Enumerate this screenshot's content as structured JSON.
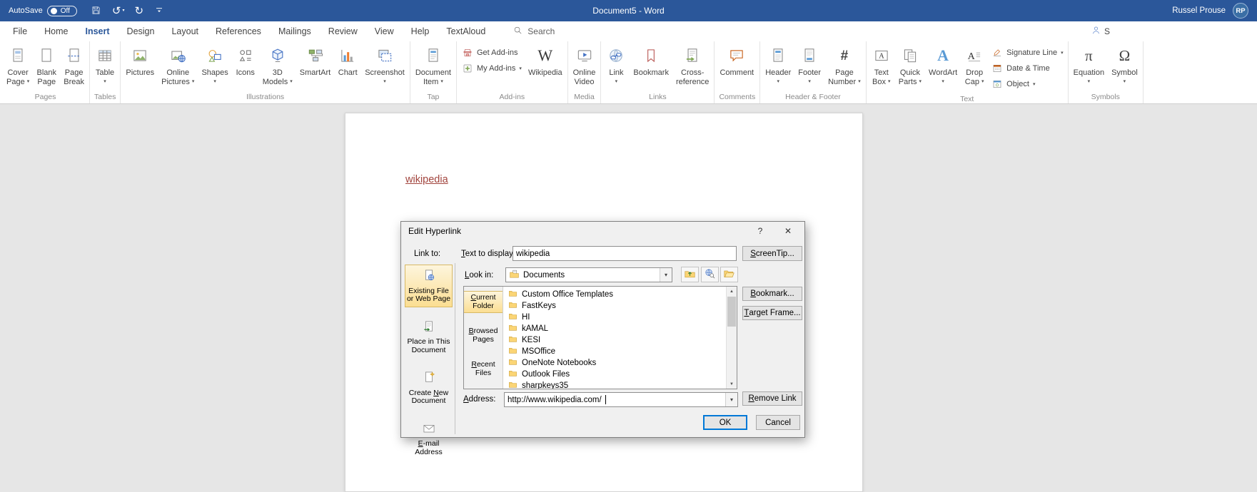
{
  "colors": {
    "title_bar": "#2b579a",
    "accent": "#2b579a",
    "selection_amber": "#fbde92",
    "hyperlink": "#a2453e",
    "ok_focus_border": "#0078d7"
  },
  "titlebar": {
    "autosave_label": "AutoSave",
    "autosave_state": "Off",
    "title": "Document5 - Word",
    "user_name": "Russel Prouse",
    "user_initials": "RP"
  },
  "menu": {
    "tabs": [
      {
        "label": "File"
      },
      {
        "label": "Home"
      },
      {
        "label": "Insert",
        "active": true
      },
      {
        "label": "Design"
      },
      {
        "label": "Layout"
      },
      {
        "label": "References"
      },
      {
        "label": "Mailings"
      },
      {
        "label": "Review"
      },
      {
        "label": "View"
      },
      {
        "label": "Help"
      },
      {
        "label": "TextAloud"
      }
    ],
    "search_label": "Search",
    "share_fragment": "S"
  },
  "ribbon": {
    "groups": [
      {
        "label": "Pages",
        "items": [
          {
            "type": "large",
            "lines": [
              "Cover",
              "Page"
            ],
            "icon": "cover-page",
            "caret": true
          },
          {
            "type": "large",
            "lines": [
              "Blank",
              "Page"
            ],
            "icon": "blank-page"
          },
          {
            "type": "large",
            "lines": [
              "Page",
              "Break"
            ],
            "icon": "page-break"
          }
        ]
      },
      {
        "label": "Tables",
        "items": [
          {
            "type": "large",
            "lines": [
              "Table"
            ],
            "icon": "table",
            "caret": true
          }
        ]
      },
      {
        "label": "Illustrations",
        "items": [
          {
            "type": "large",
            "lines": [
              "Pictures"
            ],
            "icon": "pictures"
          },
          {
            "type": "large",
            "lines": [
              "Online",
              "Pictures"
            ],
            "icon": "online-pictures",
            "caret": true
          },
          {
            "type": "large",
            "lines": [
              "Shapes"
            ],
            "icon": "shapes",
            "caret": true
          },
          {
            "type": "large",
            "lines": [
              "Icons"
            ],
            "icon": "icons"
          },
          {
            "type": "large",
            "lines": [
              "3D",
              "Models"
            ],
            "icon": "three-d-models",
            "caret": true
          },
          {
            "type": "large",
            "lines": [
              "SmartArt"
            ],
            "icon": "smartart"
          },
          {
            "type": "large",
            "lines": [
              "Chart"
            ],
            "icon": "chart"
          },
          {
            "type": "large",
            "lines": [
              "Screenshot"
            ],
            "icon": "screenshot",
            "caret": true
          }
        ]
      },
      {
        "label": "Tap",
        "items": [
          {
            "type": "large",
            "lines": [
              "Document",
              "Item"
            ],
            "icon": "document-item",
            "caret": true
          }
        ]
      },
      {
        "label": "Add-ins",
        "items": [
          {
            "type": "stack",
            "rows": [
              {
                "label": "Get Add-ins",
                "icon": "store"
              },
              {
                "label": "My Add-ins",
                "icon": "my-add-ins",
                "caret": true
              }
            ]
          },
          {
            "type": "large",
            "lines": [
              "Wikipedia"
            ],
            "icon": "wikipedia"
          }
        ]
      },
      {
        "label": "Media",
        "items": [
          {
            "type": "large",
            "lines": [
              "Online",
              "Video"
            ],
            "icon": "online-video"
          }
        ]
      },
      {
        "label": "Links",
        "items": [
          {
            "type": "large",
            "lines": [
              "Link"
            ],
            "icon": "link",
            "caret": true
          },
          {
            "type": "large",
            "lines": [
              "Bookmark"
            ],
            "icon": "bookmark"
          },
          {
            "type": "large",
            "lines": [
              "Cross-",
              "reference"
            ],
            "icon": "cross-reference"
          }
        ]
      },
      {
        "label": "Comments",
        "items": [
          {
            "type": "large",
            "lines": [
              "Comment"
            ],
            "icon": "comment"
          }
        ]
      },
      {
        "label": "Header & Footer",
        "items": [
          {
            "type": "large",
            "lines": [
              "Header"
            ],
            "icon": "header",
            "caret": true
          },
          {
            "type": "large",
            "lines": [
              "Footer"
            ],
            "icon": "footer",
            "caret": true
          },
          {
            "type": "large",
            "lines": [
              "Page",
              "Number"
            ],
            "icon": "page-number",
            "caret": true
          }
        ]
      },
      {
        "label": "Text",
        "items": [
          {
            "type": "large",
            "lines": [
              "Text",
              "Box"
            ],
            "icon": "text-box",
            "caret": true
          },
          {
            "type": "large",
            "lines": [
              "Quick",
              "Parts"
            ],
            "icon": "quick-parts",
            "caret": true
          },
          {
            "type": "large",
            "lines": [
              "WordArt"
            ],
            "icon": "wordart",
            "caret": true
          },
          {
            "type": "large",
            "lines": [
              "Drop",
              "Cap"
            ],
            "icon": "drop-cap",
            "caret": true
          },
          {
            "type": "stack",
            "rows": [
              {
                "label": "Signature Line",
                "icon": "signature-line",
                "caret": true
              },
              {
                "label": "Date & Time",
                "icon": "date-time"
              },
              {
                "label": "Object",
                "icon": "object",
                "caret": true
              }
            ]
          }
        ]
      },
      {
        "label": "Symbols",
        "items": [
          {
            "type": "large",
            "lines": [
              "Equation"
            ],
            "icon": "equation",
            "caret": true
          },
          {
            "type": "large",
            "lines": [
              "Symbol"
            ],
            "icon": "symbol",
            "caret": true
          }
        ]
      }
    ]
  },
  "document": {
    "link_text": "wikipedia"
  },
  "dialog": {
    "title": "Edit Hyperlink",
    "help_glyph": "?",
    "close_glyph": "✕",
    "link_to_label": "Link to:",
    "text_to_display": {
      "text": "Text to display:",
      "accel": 0
    },
    "text_to_display_value": "wikipedia",
    "screentip_button": {
      "text": "ScreenTip...",
      "accel": 0
    },
    "look_in": {
      "text": "Look in:",
      "accel": 0
    },
    "look_in_value": "Documents",
    "sidebar": [
      {
        "label": "Existing File or Web Page",
        "icon": "existing-file",
        "selected": true
      },
      {
        "label": "Place in This Document",
        "icon": "place-in-doc"
      },
      {
        "label": "Create New Document",
        "icon": "new-doc",
        "accel": 7
      },
      {
        "label": "E-mail Address",
        "icon": "email",
        "accel": 0
      }
    ],
    "browse_tabs": [
      {
        "label": "Current Folder",
        "accel": 0,
        "selected": true
      },
      {
        "label": "Browsed Pages",
        "accel": 0
      },
      {
        "label": "Recent Files",
        "accel": 0
      }
    ],
    "folders": [
      "Custom Office Templates",
      "FastKeys",
      "HI",
      "kAMAL",
      "KESI",
      "MSOffice",
      "OneNote Notebooks",
      "Outlook Files",
      "sharpkeys35"
    ],
    "bookmark_button": {
      "text": "Bookmark...",
      "accel": 0
    },
    "target_frame_button": {
      "text": "Target Frame...",
      "accel": 0
    },
    "address_label": {
      "text": "Address:",
      "accel": 0
    },
    "address_value": "http://www.wikipedia.com/",
    "remove_link_button": {
      "text": "Remove Link",
      "accel": 0
    },
    "ok_button": "OK",
    "cancel_button": "Cancel"
  },
  "icons": {
    "search-icon": "magnifier",
    "save-icon": "floppy-disk",
    "undo-icon": "↺",
    "redo-icon": "↻",
    "customize-qat-icon": "bar-with-caret",
    "share-icon": "person",
    "dropdown-caret": "▾",
    "folder-icon": "yellow-folder",
    "scroll-up-arrow": "▲",
    "scroll-down-arrow": "▼",
    "text-cursor": "caret-bar"
  }
}
